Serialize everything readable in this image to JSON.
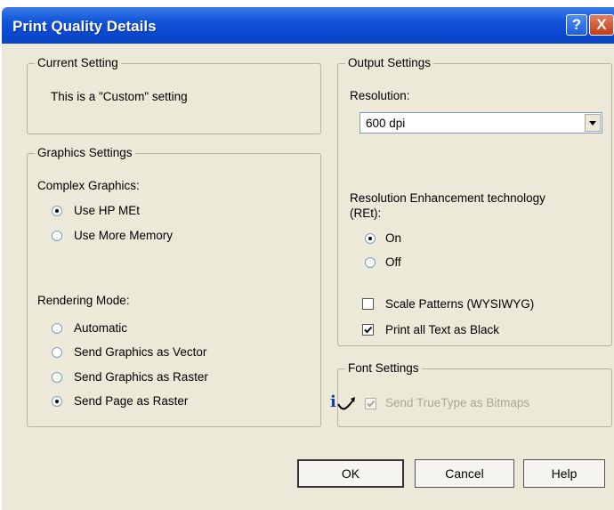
{
  "window": {
    "title": "Print Quality Details",
    "help_icon": "?",
    "close_icon": "X"
  },
  "current_setting": {
    "legend": "Current Setting",
    "text": "This is a \"Custom\" setting"
  },
  "graphics_settings": {
    "legend": "Graphics Settings",
    "complex_label": "Complex Graphics:",
    "complex_options": [
      {
        "label": "Use HP MEt",
        "selected": true
      },
      {
        "label": "Use More Memory",
        "selected": false
      }
    ],
    "rendering_label": "Rendering Mode:",
    "rendering_options": [
      {
        "label": "Automatic",
        "selected": false
      },
      {
        "label": "Send Graphics as Vector",
        "selected": false
      },
      {
        "label": "Send Graphics as Raster",
        "selected": false
      },
      {
        "label": "Send Page as Raster",
        "selected": true
      }
    ]
  },
  "output_settings": {
    "legend": "Output Settings",
    "resolution_label": "Resolution:",
    "resolution_value": "600 dpi",
    "ret_label_line1": "Resolution Enhancement technology",
    "ret_label_line2": "(REt):",
    "ret_options": [
      {
        "label": "On",
        "selected": true
      },
      {
        "label": "Off",
        "selected": false
      }
    ],
    "scale_patterns": {
      "label": "Scale Patterns (WYSIWYG)",
      "checked": false
    },
    "print_black": {
      "label": "Print all Text as Black",
      "checked": true
    }
  },
  "font_settings": {
    "legend": "Font Settings",
    "truetype": {
      "label": "Send TrueType as Bitmaps",
      "checked": true,
      "disabled": true
    },
    "info_icon": "i"
  },
  "buttons": {
    "ok": "OK",
    "cancel": "Cancel",
    "help": "Help"
  }
}
